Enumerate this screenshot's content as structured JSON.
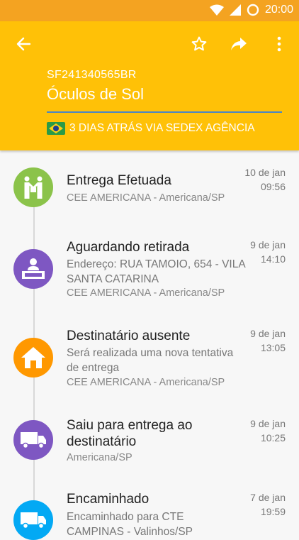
{
  "status_bar": {
    "time": "20:00"
  },
  "header": {
    "tracking_code": "SF241340565BR",
    "title": "Óculos de Sol",
    "subtitle": "3 DIAS ATRÁS VIA SEDEX AGÊNCIA",
    "icons": [
      "back-arrow-icon",
      "star-icon",
      "share-icon",
      "more-vert-icon"
    ]
  },
  "colors": {
    "header": "#ffc107",
    "status_bar": "#f4a321",
    "green": "#8bc34a",
    "purple": "#7e57c2",
    "orange": "#ff9800",
    "blue": "#03a9f4"
  },
  "events": [
    {
      "title": "Entrega Efetuada",
      "detail": [],
      "agency": "CEE AMERICANA - Americana/SP",
      "date": "10 de jan",
      "time": "09:56",
      "icon": "handover-icon",
      "color": "#8bc34a"
    },
    {
      "title": "Aguardando retirada",
      "detail": [
        "Endereço: RUA TAMOIO, 654 - VILA",
        "SANTA CATARINA"
      ],
      "agency": "CEE AMERICANA - Americana/SP",
      "date": "9 de jan",
      "time": "14:10",
      "icon": "counter-clerk-icon",
      "color": "#7e57c2"
    },
    {
      "title": "Destinatário ausente",
      "detail": [
        "Será realizada uma nova tentativa",
        "de entrega"
      ],
      "agency": "CEE AMERICANA - Americana/SP",
      "date": "9 de jan",
      "time": "13:05",
      "icon": "house-icon",
      "color": "#ff9800"
    },
    {
      "title": "Saiu para entrega ao",
      "title2": "destinatário",
      "detail": [],
      "agency": "Americana/SP",
      "date": "9 de jan",
      "time": "10:25",
      "icon": "delivery-truck-icon",
      "color": "#7e57c2"
    },
    {
      "title": "Encaminhado",
      "detail": [
        "Encaminhado para CTE",
        "CAMPINAS - Valinhos/SP"
      ],
      "agency": "",
      "date": "7 de jan",
      "time": "19:59",
      "icon": "truck-icon",
      "color": "#03a9f4"
    }
  ]
}
